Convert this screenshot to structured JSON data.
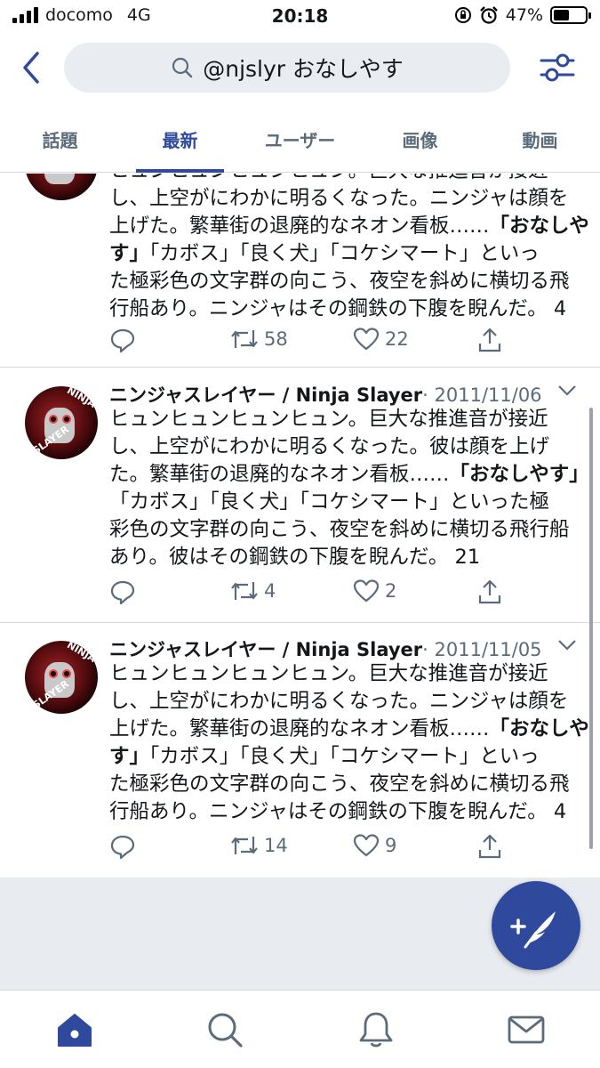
{
  "status_bar": {
    "carrier": "docomo",
    "network": "4G",
    "time": "20:18",
    "battery": "47%"
  },
  "search": {
    "query": "@njslyr おなしやす"
  },
  "tabs": [
    {
      "label": "話題"
    },
    {
      "label": "最新",
      "active": true
    },
    {
      "label": "ユーザー"
    },
    {
      "label": "画像"
    },
    {
      "label": "動画"
    }
  ],
  "tweets": [
    {
      "lines": [
        "ヒュンヒュンヒュンヒュン。巨大な推進音が接近",
        "し、上空がにわかに明るくなった。ニンジャは顔を",
        "上げた。繁華街の退廃的なネオン看板……「おなしや",
        "す」「カボス」「良く犬」「コケシマート」といっ",
        "た極彩色の文字群の向こう、夜空を斜めに横切る飛",
        "行船あり。ニンジャはその鋼鉄の下腹を睨んだ。 4"
      ],
      "retweets": "58",
      "likes": "22"
    },
    {
      "name": "ニンジャスレイヤー / Ninja Slayer",
      "date": "· 2011/11/06",
      "lines": [
        "ヒュンヒュンヒュンヒュン。巨大な推進音が接近",
        "し、上空がにわかに明るくなった。彼は顔を上げ",
        "た。繁華街の退廃的なネオン看板……「おなしやす」",
        "「カボス」「良く犬」「コケシマート」といった極",
        "彩色の文字群の向こう、夜空を斜めに横切る飛行船",
        "あり。彼はその鋼鉄の下腹を睨んだ。 21"
      ],
      "retweets": "4",
      "likes": "2"
    },
    {
      "name": "ニンジャスレイヤー / Ninja Slayer",
      "date": "· 2011/11/05",
      "lines": [
        "ヒュンヒュンヒュンヒュン。巨大な推進音が接近",
        "し、上空がにわかに明るくなった。ニンジャは顔を",
        "上げた。繁華街の退廃的なネオン看板……「おなしや",
        "す」「カボス」「良く犬」「コケシマート」といっ",
        "た極彩色の文字群の向こう、夜空を斜めに横切る飛",
        "行船あり。ニンジャはその鋼鉄の下腹を睨んだ。 4"
      ],
      "retweets": "14",
      "likes": "9"
    }
  ],
  "avatar_text": "NINJA SLAYER",
  "colors": {
    "accent": "#2f4a9c",
    "secondary_text": "#5b6b7a",
    "search_bg": "#e9edf1"
  },
  "icons": {
    "back": "chevron-left-icon",
    "search": "search-icon",
    "filter": "sliders-icon",
    "reply": "reply-icon",
    "retweet": "retweet-icon",
    "like": "heart-icon",
    "share": "share-icon",
    "compose": "compose-feather-icon",
    "home": "home-icon",
    "explore": "search-icon",
    "notifications": "bell-icon",
    "messages": "envelope-icon"
  }
}
